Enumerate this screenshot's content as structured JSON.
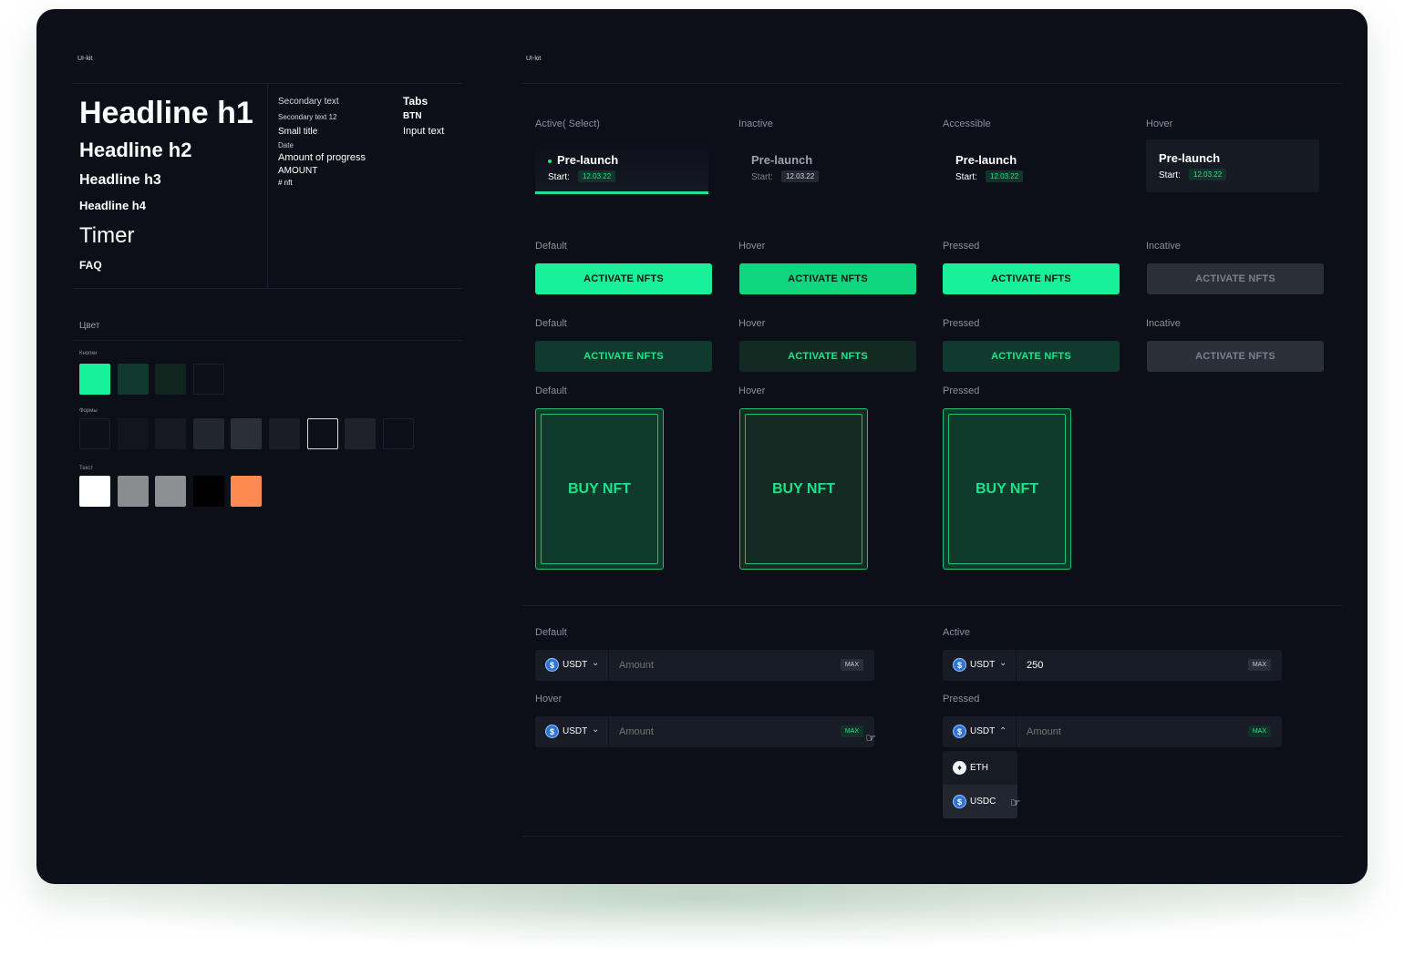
{
  "left": {
    "title": "UI-kit",
    "headlines": [
      "Headline h1",
      "Headline h2",
      "Headline h3",
      "Headline h4",
      "Timer",
      "FAQ"
    ],
    "text_styles": [
      "Secondary text",
      "Secondary text 12",
      "Small title",
      "Date",
      "Amount of progress",
      "AMOUNT",
      "# nft"
    ],
    "text_styles2": [
      "Tabs",
      "BTN",
      "Input text"
    ],
    "color_title": "Цвет",
    "color_groups": [
      "Кнопки",
      "Формы",
      "Текст"
    ],
    "colors": {
      "buttons": [
        "#17f29a",
        "#0f3a2d",
        "#11241d",
        "#0c0f17"
      ],
      "forms": [
        "#0d1017",
        "#12151d",
        "#171a23",
        "#22262f",
        "#2b2f38",
        "#1a1d25",
        "#0c0f17",
        "#1f222b",
        "#0c0f17"
      ],
      "text": [
        "#ffffff",
        "#8a8c8f",
        "#8d8f92",
        "#000000",
        "#fe8a52"
      ]
    }
  },
  "right": {
    "title": "UI-kit",
    "tab_states": [
      "Active( Select)",
      "Inactive",
      "Accessible",
      "Hover"
    ],
    "tab_title": "Pre-launch",
    "tab_start": "Start:",
    "tab_date": "12.03.22",
    "btn_states_1": [
      "Default",
      "Hover",
      "Pressed",
      "Incative"
    ],
    "btn_states_2": [
      "Default",
      "Hover",
      "Pressed",
      "Incative"
    ],
    "btn_label": "ACTIVATE NFTS",
    "card_states": [
      "Default",
      "Hover",
      "Pressed"
    ],
    "card_label": "BUY NFT",
    "input_states": [
      "Default",
      "Hover",
      "Active",
      "Pressed"
    ],
    "currency": "USDT",
    "placeholder": "Amount",
    "active_value": "250",
    "max_label": "MAX",
    "dropdown": [
      "ETH",
      "USDC"
    ]
  }
}
